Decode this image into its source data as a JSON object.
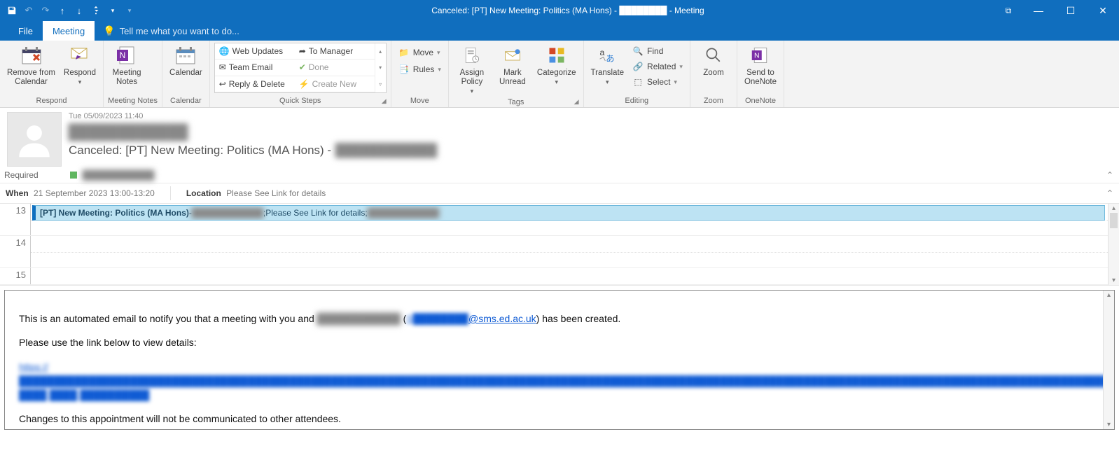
{
  "title": "Canceled: [PT] New Meeting: Politics (MA Hons) - ████████ - Meeting",
  "tabs": {
    "file": "File",
    "meeting": "Meeting"
  },
  "tellme": "Tell me what you want to do...",
  "ribbon": {
    "respond": {
      "label": "Respond",
      "remove": "Remove from\nCalendar",
      "respond": "Respond"
    },
    "meetingnotes": {
      "label": "Meeting Notes",
      "btn": "Meeting\nNotes"
    },
    "calendar": {
      "label": "Calendar",
      "btn": "Calendar"
    },
    "quicksteps": {
      "label": "Quick Steps",
      "webupdates": "Web Updates",
      "tomanager": "To Manager",
      "teamemail": "Team Email",
      "done": "Done",
      "replydelete": "Reply & Delete",
      "createnew": "Create New"
    },
    "move": {
      "label": "Move",
      "move": "Move",
      "rules": "Rules"
    },
    "tags": {
      "label": "Tags",
      "assign": "Assign\nPolicy",
      "markunread": "Mark\nUnread",
      "categorize": "Categorize"
    },
    "editing": {
      "label": "Editing",
      "translate": "Translate",
      "find": "Find",
      "related": "Related",
      "select": "Select"
    },
    "zoom": {
      "label": "Zoom",
      "btn": "Zoom"
    },
    "onenote": {
      "label": "OneNote",
      "btn": "Send to\nOneNote"
    }
  },
  "header": {
    "date": "Tue 05/09/2023 11:40",
    "sender": "████████████",
    "subject_prefix": "Canceled: [PT] New Meeting: Politics (MA Hons) - ",
    "subject_blur": "████████████",
    "required_label": "Required",
    "required_name": "████████████"
  },
  "info": {
    "when_label": "When",
    "when_value": "21 September 2023 13:00-13:20",
    "location_label": "Location",
    "location_value": "Please See Link for details"
  },
  "calendar": {
    "hours": [
      "13",
      "14",
      "15"
    ],
    "appt_title": "[PT] New Meeting: Politics (MA Hons)",
    "appt_sep": " - ",
    "appt_blur1": "████████████",
    "appt_mid_sep": "; ",
    "appt_mid": "Please See Link for details; ",
    "appt_blur2": "████████████"
  },
  "body": {
    "p1_a": "This is an automated email to notify you that a meeting with you and ",
    "p1_blur": "████████████",
    "p1_b": " (",
    "email_a": "S████████",
    "email_b": "@sms.ed.ac.uk",
    "p1_c": ") has been created.",
    "p2": "Please use the link below to view details:",
    "link": "https://████████████████████████████████████████████████████████████████████████████████████████████████████████████████████████████████████████████████████████████████████████████████████████████ ████ ████ ██████████",
    "p3": "Changes to this appointment will not be communicated to other attendees."
  }
}
